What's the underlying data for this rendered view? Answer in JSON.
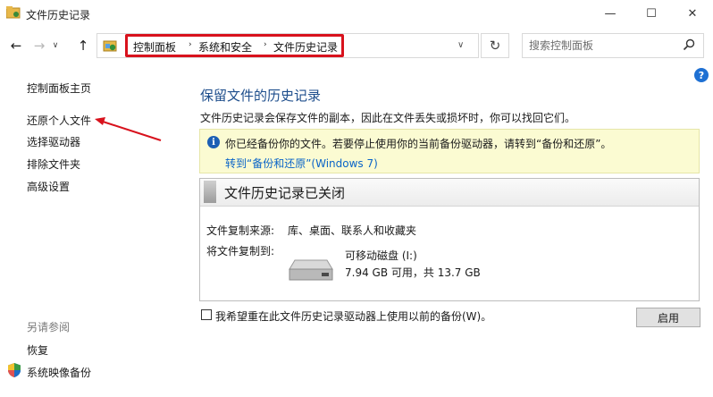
{
  "window": {
    "title": "文件历史记录",
    "minimize_glyph": "—",
    "maximize_glyph": "☐",
    "close_glyph": "✕"
  },
  "nav": {
    "back_glyph": "←",
    "forward_glyph": "→",
    "recent_glyph": "∨",
    "up_glyph": "↑",
    "refresh_glyph": "↻",
    "dropdown_glyph": "∨"
  },
  "breadcrumb": [
    "控制面板",
    "系统和安全",
    "文件历史记录"
  ],
  "breadcrumb_sep": "›",
  "search": {
    "placeholder": "搜索控制面板",
    "icon": "search-icon"
  },
  "help": {
    "label": "?"
  },
  "sidebar": {
    "items": [
      {
        "label": "控制面板主页"
      },
      {
        "label": "还原个人文件"
      },
      {
        "label": "选择驱动器"
      },
      {
        "label": "排除文件夹"
      },
      {
        "label": "高级设置"
      }
    ],
    "see_also_title": "另请参阅",
    "see_also_items": [
      {
        "label": "恢复"
      },
      {
        "label": "系统映像备份"
      }
    ]
  },
  "main": {
    "heading": "保留文件的历史记录",
    "description": "文件历史记录会保存文件的副本，因此在文件丢失或损坏时，你可以找回它们。",
    "info_icon": "i",
    "info_text": "你已经备份你的文件。若要停止使用你的当前备份驱动器，请转到“备份和还原”。",
    "info_link": "转到“备份和还原”(Windows 7)",
    "status_title": "文件历史记录已关闭",
    "source_label": "文件复制来源:",
    "source_value": "库、桌面、联系人和收藏夹",
    "dest_label": "将文件复制到:",
    "drive_name": "可移动磁盘 (I:)",
    "drive_space": "7.94 GB 可用，共 13.7 GB",
    "checkbox_label": "我希望重在此文件历史记录驱动器上使用以前的备份(W)。",
    "enable_button": "启用"
  },
  "colors": {
    "heading": "#1e4e8c",
    "link": "#0a64c8",
    "info_bg": "#fbfbd2",
    "annotation_red": "#d8121d"
  }
}
